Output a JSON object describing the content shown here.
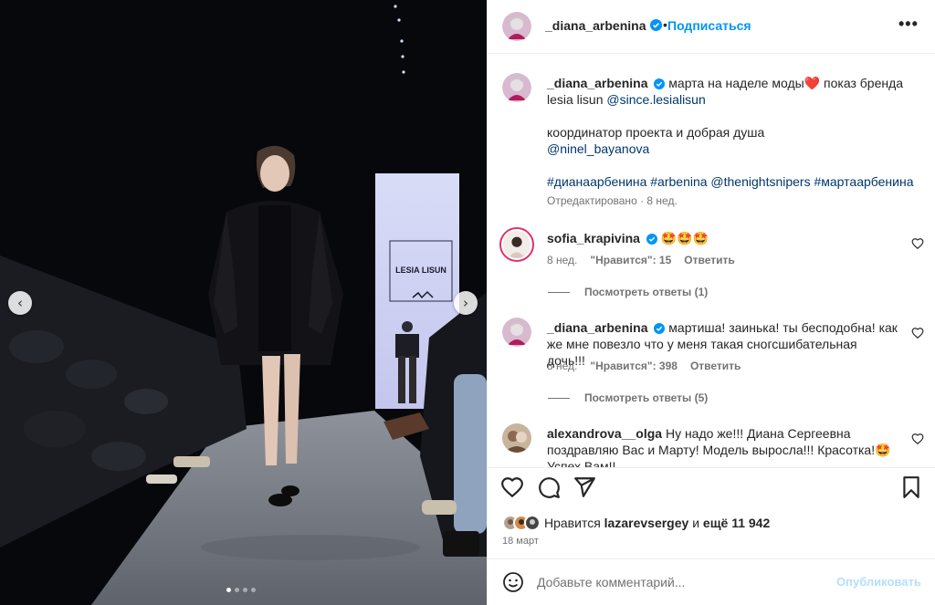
{
  "media": {
    "nav_prev_icon": "‹",
    "nav_next_icon": "›",
    "banner_text": "LESIA LISUN",
    "dots_count": 4
  },
  "header": {
    "username": "_diana_arbenina",
    "separator": "•",
    "follow_label": "Подписаться",
    "more_icon": "•••"
  },
  "caption": {
    "username": "_diana_arbenina",
    "text_part1": "марта на наделе моды",
    "heart": "❤️",
    "text_part2": " показ бренда lesia lisun ",
    "mention1": "@since.lesialisun",
    "line2": "координатор проекта и добрая душа",
    "mention2": "@ninel_bayanova",
    "tags": "#дианаарбенина #arbenina @thenightsnipers #мартаарбенина",
    "edited": "Отредактировано · 8 нед."
  },
  "comments": [
    {
      "username": "sofia_krapivina",
      "text": "🤩🤩🤩",
      "age": "8 нед.",
      "likes": "\"Нравится\": 15",
      "reply": "Ответить",
      "view_replies": "Посмотреть ответы (1)"
    },
    {
      "username": "_diana_arbenina",
      "text": "мартиша! заинька! ты бесподобна! как же мне повезло что у меня такая сногсшибательная дочь!!!",
      "age": "8 нед.",
      "likes": "\"Нравится\": 398",
      "reply": "Ответить",
      "view_replies": "Посмотреть ответы (5)"
    },
    {
      "username": "alexandrova__olga",
      "text": "Ну надо же!!! Диана Сергеевна поздравляю Вас и Марту! Модель выросла!!! Красотка!🤩 Успех Вам!!"
    }
  ],
  "actions": {
    "liked_by_prefix": "Нравится",
    "liked_by_user": "lazarevsergey",
    "liked_by_and": "и",
    "liked_by_more": "ещё 11 942",
    "date": "18 март"
  },
  "add_comment": {
    "placeholder": "Добавьте комментарий...",
    "publish_label": "Опубликовать"
  },
  "colors": {
    "accent": "#0095f6",
    "verified": "#0095f6",
    "link": "#00376b",
    "muted": "#737373",
    "publish_disabled": "#b2dffc"
  }
}
